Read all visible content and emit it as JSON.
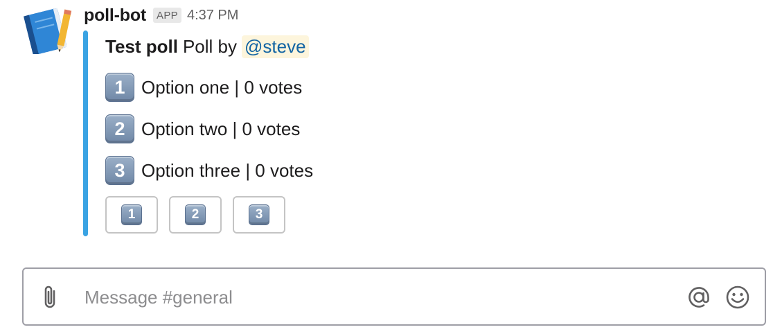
{
  "message": {
    "sender": "poll-bot",
    "badge": "APP",
    "timestamp": "4:37 PM",
    "avatar_icon": "notebook-pencil-icon"
  },
  "poll": {
    "title": "Test poll",
    "by_text": "Poll by",
    "author_mention": "@steve",
    "accent_color": "#3aa3e3",
    "options": [
      {
        "number": "1",
        "text": "Option one | 0 votes",
        "votes": 0
      },
      {
        "number": "2",
        "text": "Option two | 0 votes",
        "votes": 0
      },
      {
        "number": "3",
        "text": "Option three | 0 votes",
        "votes": 0
      }
    ],
    "buttons": [
      {
        "label": "1"
      },
      {
        "label": "2"
      },
      {
        "label": "3"
      }
    ]
  },
  "composer": {
    "placeholder": "Message #general",
    "attach_icon": "paperclip-icon",
    "mention_icon": "at-sign-icon",
    "emoji_icon": "smiley-icon"
  }
}
